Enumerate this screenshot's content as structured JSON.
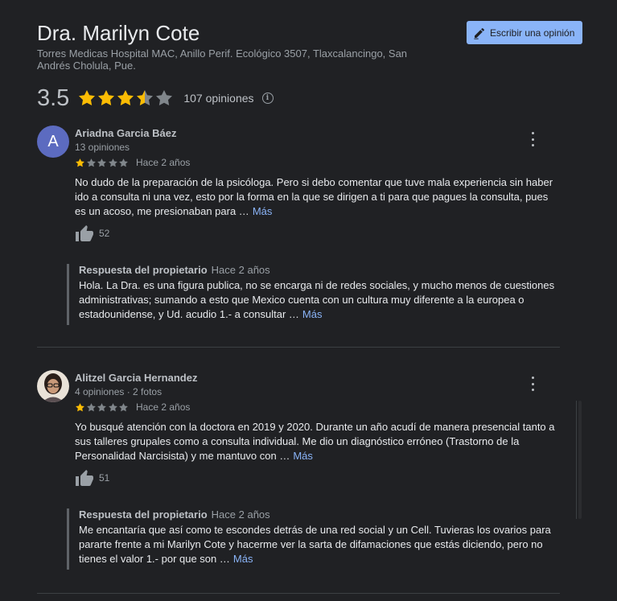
{
  "place": {
    "title": "Dra. Marilyn Cote",
    "address": "Torres Medicas Hospital MAC, Anillo Perif. Ecológico 3507, Tlaxcalancingo, San Andrés Cholula, Pue."
  },
  "write_review": {
    "label": "Escribir una opinión",
    "icon": "pencil-icon"
  },
  "rating": {
    "value": "3.5",
    "stars": 3.5,
    "count_label": "107 opiniones",
    "star_color": "#fbbc04"
  },
  "reviews": [
    {
      "avatar_letter": "A",
      "avatar_color": "#5c6bc0",
      "name": "Ariadna Garcia Báez",
      "meta": "13 opiniones",
      "stars": 1,
      "date": "Hace 2 años",
      "text": "No dudo de la preparación de la psicóloga. Pero si debo comentar que tuve mala experiencia sin haber ido a consulta ni una vez, esto por la forma en la que se dirigen a ti para que pagues la consulta, pues es un acoso, me presionaban para …",
      "more": "Más",
      "likes": "52",
      "reply": {
        "owner": "Respuesta del propietario",
        "date": "Hace 2 años",
        "text": "Hola. La Dra. es una figura publica, no se encarga ni de redes sociales, y mucho menos de cuestiones administrativas; sumando a esto que Mexico cuenta con un cultura muy diferente a la europea o estadounidense, y Ud. acudio 1.- a consultar …",
        "more": "Más"
      }
    },
    {
      "avatar_letter": "",
      "name": "Alitzel Garcia Hernandez",
      "meta": "4 opiniones · 2 fotos",
      "stars": 1,
      "date": "Hace 2 años",
      "text": "Yo busqué atención con la doctora en 2019 y 2020. Durante un año acudí de manera presencial tanto a sus talleres grupales como a consulta individual. Me dio un diagnóstico erróneo (Trastorno de la Personalidad Narcisista) y me mantuvo con …",
      "more": "Más",
      "likes": "51",
      "reply": {
        "owner": "Respuesta del propietario",
        "date": "Hace 2 años",
        "text": "Me encantaría que así como te escondes detrás de una red social y un Cell. Tuvieras los ovarios para pararte frente a mi Marilyn Cote y hacerme ver la sarta de difamaciones que estás diciendo, pero no tienes el valor 1.- por que son …",
        "more": "Más"
      }
    }
  ]
}
